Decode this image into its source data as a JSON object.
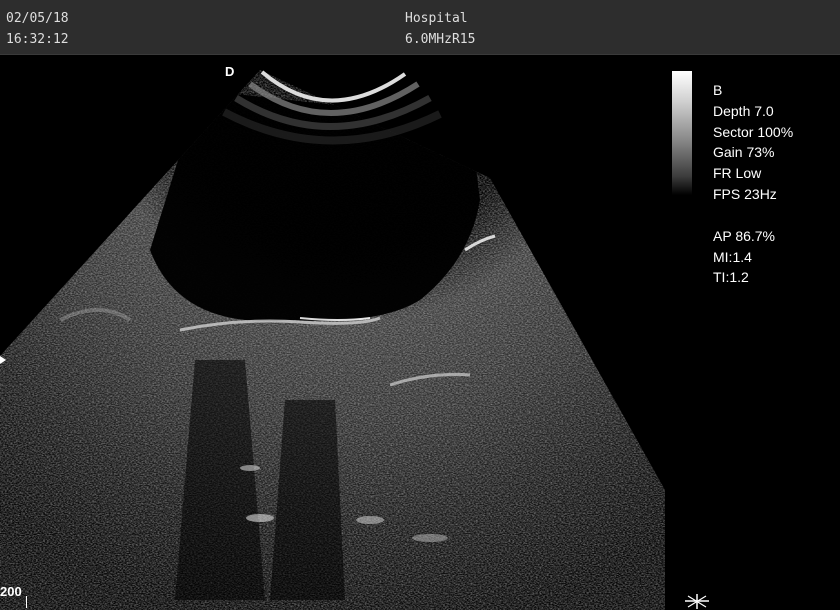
{
  "header": {
    "date": "02/05/18",
    "time": "16:32:12",
    "institution": "Hospital",
    "probe": "6.0MHzR15"
  },
  "image": {
    "orientation_marker": "D",
    "scale_label": "200"
  },
  "params": {
    "mode": "B",
    "depth": "Depth 7.0",
    "sector": "Sector 100%",
    "gain": "Gain 73%",
    "frame_rate": "FR Low",
    "fps": "FPS 23Hz",
    "acoustic_power": "AP 86.7%",
    "mechanical_index": "MI:1.4",
    "thermal_index": "TI:1.2"
  },
  "icons": {
    "gray_scale_bar": "gray-scale-bar",
    "focus_marker": "focus-marker-icon",
    "depth_marker": "depth-marker-icon"
  }
}
